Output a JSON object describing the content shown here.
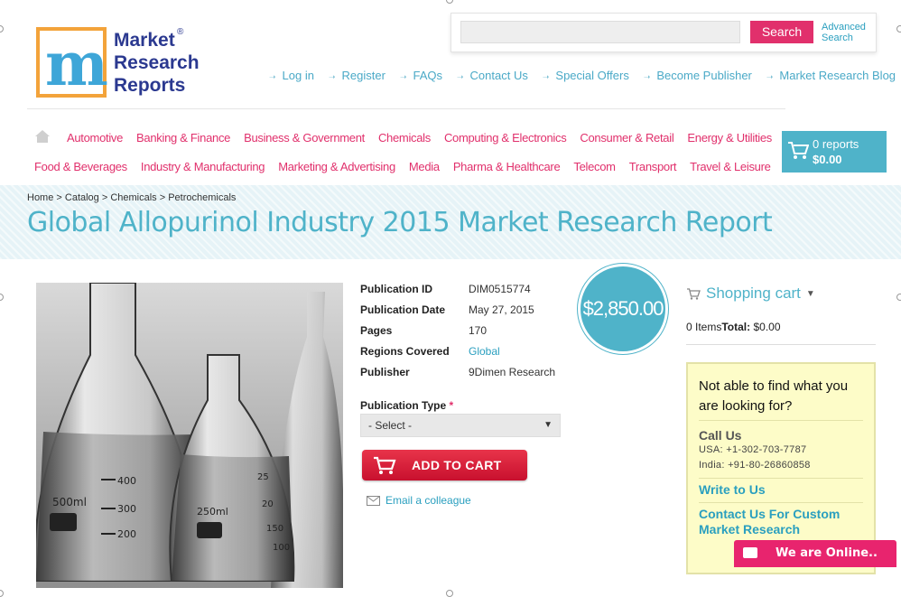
{
  "logo": {
    "line1": "Market",
    "line2": "Research",
    "line3": "Reports",
    "reg": "®"
  },
  "search": {
    "placeholder": "",
    "button_label": "Search",
    "advanced_label_1": "Advanced",
    "advanced_label_2": "Search"
  },
  "top_links": [
    "Log in",
    "Register",
    "FAQs",
    "Contact Us",
    "Special Offers",
    "Become Publisher",
    "Market Research Blog"
  ],
  "categories_row1": [
    "Automotive",
    "Banking & Finance",
    "Business & Government",
    "Chemicals",
    "Computing & Electronics",
    "Consumer & Retail",
    "Energy & Utilities"
  ],
  "categories_row2": [
    "Food & Beverages",
    "Industry & Manufacturing",
    "Marketing & Advertising",
    "Media",
    "Pharma & Healthcare",
    "Telecom",
    "Transport",
    "Travel & Leisure"
  ],
  "header_cart": {
    "count": "0 reports",
    "total": "$0.00"
  },
  "breadcrumb": "Home > Catalog > Chemicals > Petrochemicals",
  "page_title": "Global Allopurinol Industry 2015 Market Research Report",
  "details": [
    {
      "label": "Publication ID",
      "value": "DIM0515774",
      "link": false
    },
    {
      "label": "Publication Date",
      "value": "May 27, 2015",
      "link": false
    },
    {
      "label": "Pages",
      "value": "170",
      "link": false
    },
    {
      "label": "Regions Covered",
      "value": "Global",
      "link": true
    },
    {
      "label": "Publisher",
      "value": "9Dimen Research",
      "link": false
    }
  ],
  "publication_type": {
    "label": "Publication Type",
    "required_mark": "*",
    "selected": "- Select -"
  },
  "add_to_cart_label": "ADD TO CART",
  "email_label": "Email a colleague",
  "price": "$2,850.00",
  "sidebar": {
    "cart_title": "Shopping cart",
    "items_label": "0 Items",
    "total_label": "Total:",
    "total_value": "$0.00",
    "help_question": "Not able to find what you are looking for?",
    "call_us": "Call Us",
    "phone_usa": "USA: +1-302-703-7787",
    "phone_india": "India: +91-80-26860858",
    "write_to_us": "Write to Us",
    "custom_research": "Contact Us For Custom Market Research"
  },
  "chat_label": "We are Online..",
  "colors": {
    "accent": "#4fb3c9",
    "pink": "#e1306c",
    "cart_red": "#d11a36",
    "help_bg": "#fdfcc8"
  }
}
